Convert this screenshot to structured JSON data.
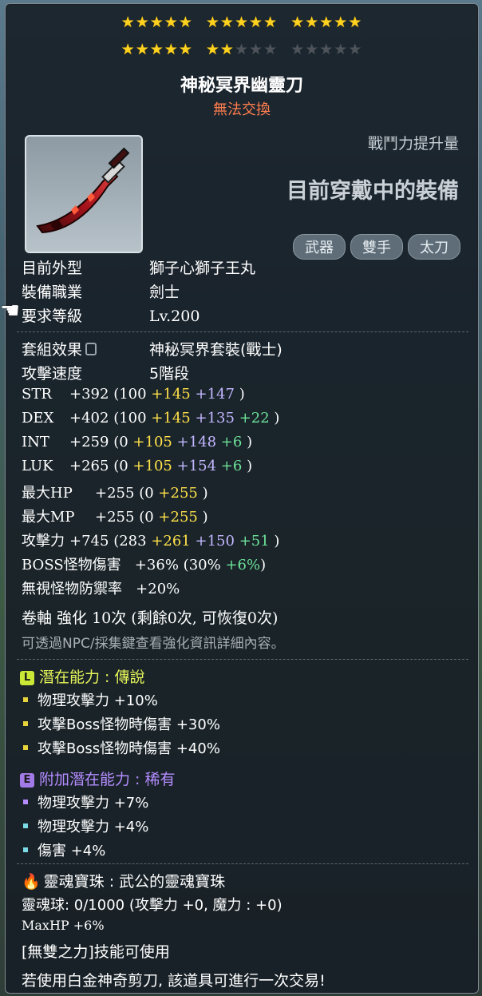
{
  "stars": {
    "filled": 22,
    "total": 30
  },
  "item": {
    "name": "神秘冥界幽靈刀",
    "trade_status": "無法交換",
    "power_label": "戰鬥力提升量",
    "equipped_label": "目前穿戴中的裝備",
    "tags": [
      "武器",
      "雙手",
      "太刀"
    ]
  },
  "info": [
    {
      "k": "目前外型",
      "v": "獅子心獅子王丸"
    },
    {
      "k": "裝備職業",
      "v": "劍士"
    },
    {
      "k": "要求等級",
      "v": "Lv.200"
    }
  ],
  "set": {
    "k": "套組效果",
    "v": "神秘冥界套裝(戰士)"
  },
  "speed": {
    "k": "攻擊速度",
    "v": "5階段"
  },
  "stats": [
    {
      "name": "STR",
      "total": "+392",
      "base": "(100",
      "y": "+145",
      "p": "+147",
      "g": "",
      "close": ")"
    },
    {
      "name": "DEX",
      "total": "+402",
      "base": "(100",
      "y": "+145",
      "p": "+135",
      "g": "+22",
      "close": ")"
    },
    {
      "name": "INT",
      "total": "+259",
      "base": "(0",
      "y": "+105",
      "p": "+148",
      "g": "+6",
      "close": ")"
    },
    {
      "name": "LUK",
      "total": "+265",
      "base": "(0",
      "y": "+105",
      "p": "+154",
      "g": "+6",
      "close": ")"
    },
    {
      "name": "最大HP",
      "total": "+255",
      "base": "(0",
      "y": "+255",
      "p": "",
      "g": "",
      "close": ")"
    },
    {
      "name": "最大MP",
      "total": "+255",
      "base": "(0",
      "y": "+255",
      "p": "",
      "g": "",
      "close": ")"
    },
    {
      "name": "攻擊力",
      "total": "+745",
      "base": "(283",
      "y": "+261",
      "p": "+150",
      "g": "+51",
      "close": ")"
    }
  ],
  "boss": {
    "label": "BOSS怪物傷害",
    "total": "+36%",
    "base": "(30%",
    "g": "+6%",
    "close": ")"
  },
  "ignore_def": {
    "label": "無視怪物防禦率",
    "val": "+20%"
  },
  "scroll": {
    "text": "卷軸 強化 10次 (剩餘0次, 可恢復0次)"
  },
  "scroll_note": "可透過NPC/採集鍵查看強化資訊詳細內容。",
  "potential": {
    "badge": "L",
    "title": "潛在能力 : 傳說",
    "lines": [
      "物理攻擊力 +10%",
      "攻擊Boss怪物時傷害 +30%",
      "攻擊Boss怪物時傷害 +40%"
    ]
  },
  "bonus_potential": {
    "badge": "E",
    "title": "附加潛在能力 : 稀有",
    "lines": [
      "物理攻擊力 +7%",
      "物理攻擊力 +4%",
      "傷害 +4%"
    ]
  },
  "soul": {
    "title": "靈魂寶珠 : 武公的靈魂寶珠",
    "orb": "靈魂球: 0/1000 (攻擊力 +0, 魔力 : +0)",
    "maxhp": "MaxHP +6%",
    "skill": "[無雙之力]技能可使用"
  },
  "trade_note": "若使用白金神奇剪刀, 該道具可進行一次交易!",
  "colors": {
    "star_on": "#ffd21f",
    "legend": "#e6f55a",
    "epic": "#b48cff",
    "red_text": "#ff7e4d"
  }
}
